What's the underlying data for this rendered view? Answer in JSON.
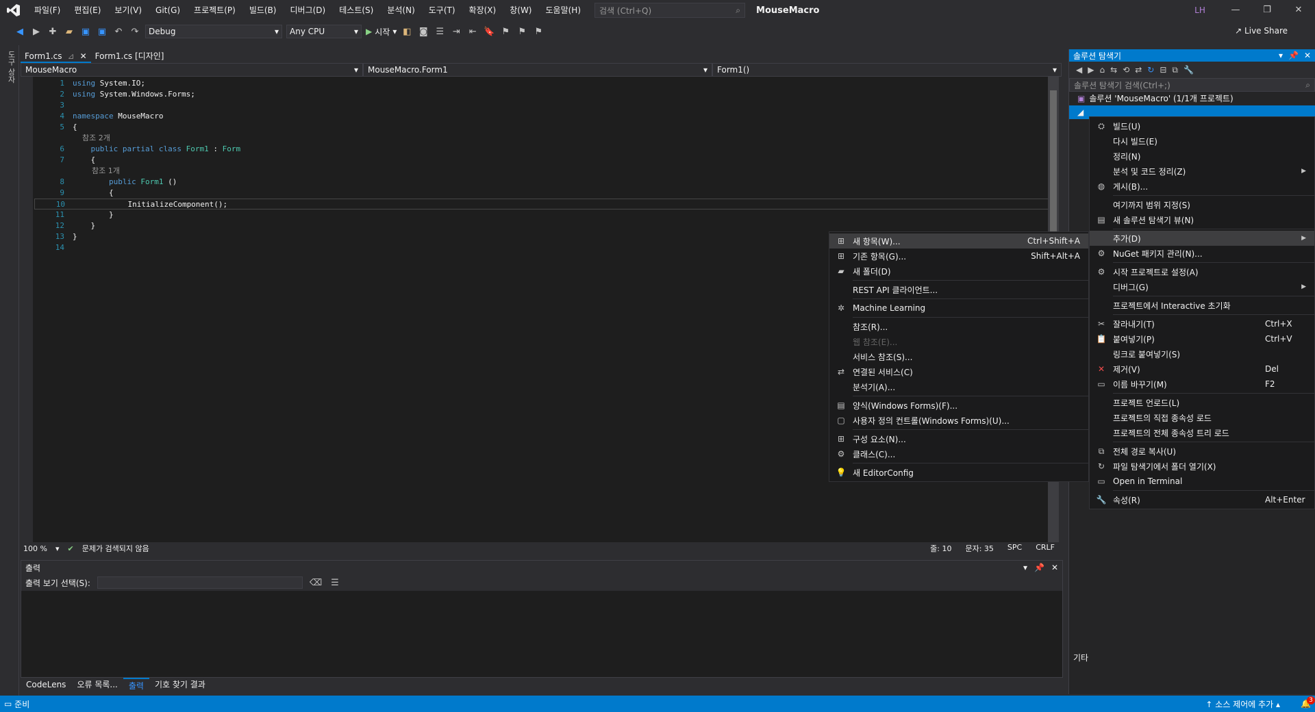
{
  "app": {
    "title": "MouseMacro",
    "user_initials": "LH",
    "accent": "#007acc"
  },
  "menu": [
    "파일(F)",
    "편집(E)",
    "보기(V)",
    "Git(G)",
    "프로젝트(P)",
    "빌드(B)",
    "디버그(D)",
    "테스트(S)",
    "분석(N)",
    "도구(T)",
    "확장(X)",
    "창(W)",
    "도움말(H)"
  ],
  "search": {
    "placeholder": "검색 (Ctrl+Q)"
  },
  "toolbar": {
    "config": "Debug",
    "platform": "Any CPU",
    "start_label": "시작",
    "live_share": "Live Share"
  },
  "left_rail": {
    "label": "도구 상자"
  },
  "doc_tabs": [
    {
      "label": "Form1.cs",
      "active": true
    },
    {
      "label": "Form1.cs [디자인]",
      "active": false
    }
  ],
  "nav_bar": {
    "project": "MouseMacro",
    "class": "MouseMacro.Form1",
    "member": "Form1()"
  },
  "code_lines": [
    {
      "num": "1",
      "parts": [
        [
          "kw",
          "using"
        ],
        [
          "",
          "System.IO;"
        ]
      ]
    },
    {
      "num": "2",
      "parts": [
        [
          "kw",
          "using"
        ],
        [
          "",
          "System.Windows.Forms;"
        ]
      ]
    },
    {
      "num": "3",
      "parts": []
    },
    {
      "num": "4",
      "parts": [
        [
          "kw",
          "namespace"
        ],
        [
          "",
          "MouseMacro"
        ]
      ]
    },
    {
      "num": "5",
      "parts": [
        [
          "",
          "{"
        ]
      ]
    },
    {
      "num": "",
      "parts": [
        [
          "ref",
          "    참조 2개"
        ]
      ]
    },
    {
      "num": "6",
      "parts": [
        [
          "kw",
          "    public partial class"
        ],
        [
          "ty",
          "Form1"
        ],
        [
          "",
          ":"
        ],
        [
          "ty",
          "Form"
        ]
      ]
    },
    {
      "num": "7",
      "parts": [
        [
          "",
          "    {"
        ]
      ]
    },
    {
      "num": "",
      "parts": [
        [
          "ref",
          "        참조 1개"
        ]
      ]
    },
    {
      "num": "8",
      "parts": [
        [
          "kw",
          "        public"
        ],
        [
          "ty",
          "Form1"
        ],
        [
          "",
          "()"
        ]
      ]
    },
    {
      "num": "9",
      "parts": [
        [
          "",
          "        {"
        ]
      ]
    },
    {
      "num": "10",
      "parts": [
        [
          "",
          "            InitializeComponent();"
        ]
      ]
    },
    {
      "num": "11",
      "parts": [
        [
          "",
          "        }"
        ]
      ]
    },
    {
      "num": "12",
      "parts": [
        [
          "",
          "    }"
        ]
      ]
    },
    {
      "num": "13",
      "parts": [
        [
          "",
          "}"
        ]
      ]
    },
    {
      "num": "14",
      "parts": []
    }
  ],
  "editor_status": {
    "zoom": "100 %",
    "issues": "문제가 검색되지 않음",
    "line": "줄: 10",
    "char": "문자: 35",
    "spc": "SPC",
    "crlf": "CRLF"
  },
  "output": {
    "title": "출력",
    "source_label": "출력 보기 선택(S):"
  },
  "bottom_tabs": [
    {
      "label": "CodeLens",
      "active": false
    },
    {
      "label": "오류 목록...",
      "active": false
    },
    {
      "label": "출력",
      "active": true
    },
    {
      "label": "기호 찾기 결과",
      "active": false
    }
  ],
  "solution_explorer": {
    "title": "솔루션 탐색기",
    "search_placeholder": "솔루션 탐색기 검색(Ctrl+;)",
    "solution_row": "솔루션 'MouseMacro' (1/1개 프로젝트)",
    "misc": "기타"
  },
  "project_menu": [
    {
      "icon": "build-icon",
      "glyph": "⛭",
      "label": "빌드(U)",
      "shortcut": ""
    },
    {
      "icon": "",
      "glyph": "",
      "label": "다시 빌드(E)",
      "shortcut": ""
    },
    {
      "icon": "",
      "glyph": "",
      "label": "정리(N)",
      "shortcut": ""
    },
    {
      "icon": "",
      "glyph": "",
      "label": "분석 및 코드 정리(Z)",
      "shortcut": "",
      "submenu": true
    },
    {
      "icon": "publish-icon",
      "glyph": "◍",
      "label": "게시(B)...",
      "shortcut": ""
    },
    {
      "sep": true
    },
    {
      "icon": "",
      "glyph": "",
      "label": "여기까지 범위 지정(S)",
      "shortcut": ""
    },
    {
      "icon": "new-view-icon",
      "glyph": "▤",
      "label": "새 솔루션 탐색기 뷰(N)",
      "shortcut": ""
    },
    {
      "sep": true
    },
    {
      "icon": "",
      "glyph": "",
      "label": "추가(D)",
      "shortcut": "",
      "submenu": true,
      "hl": true
    },
    {
      "icon": "nuget-icon",
      "glyph": "⚙",
      "label": "NuGet 패키지 관리(N)...",
      "shortcut": ""
    },
    {
      "sep": true
    },
    {
      "icon": "gear-icon",
      "glyph": "⚙",
      "label": "시작 프로젝트로 설정(A)",
      "shortcut": ""
    },
    {
      "icon": "",
      "glyph": "",
      "label": "디버그(G)",
      "shortcut": "",
      "submenu": true
    },
    {
      "sep": true
    },
    {
      "icon": "",
      "glyph": "",
      "label": "프로젝트에서 Interactive 초기화",
      "shortcut": ""
    },
    {
      "sep": true
    },
    {
      "icon": "cut-icon",
      "glyph": "✂",
      "label": "잘라내기(T)",
      "shortcut": "Ctrl+X"
    },
    {
      "icon": "paste-icon",
      "glyph": "📋",
      "label": "붙여넣기(P)",
      "shortcut": "Ctrl+V"
    },
    {
      "icon": "",
      "glyph": "",
      "label": "링크로 붙여넣기(S)",
      "shortcut": ""
    },
    {
      "icon": "remove-icon",
      "glyph": "✕",
      "label": "제거(V)",
      "shortcut": "Del",
      "red": true
    },
    {
      "icon": "rename-icon",
      "glyph": "▭",
      "label": "이름 바꾸기(M)",
      "shortcut": "F2"
    },
    {
      "sep": true
    },
    {
      "icon": "",
      "glyph": "",
      "label": "프로젝트 언로드(L)",
      "shortcut": ""
    },
    {
      "icon": "",
      "glyph": "",
      "label": "프로젝트의 직접 종속성 로드",
      "shortcut": ""
    },
    {
      "icon": "",
      "glyph": "",
      "label": "프로젝트의 전체 종속성 트리 로드",
      "shortcut": ""
    },
    {
      "sep": true
    },
    {
      "icon": "copy-icon",
      "glyph": "⧉",
      "label": "전체 경로 복사(U)",
      "shortcut": ""
    },
    {
      "icon": "open-folder-icon",
      "glyph": "↻",
      "label": "파일 탐색기에서 폴더 열기(X)",
      "shortcut": ""
    },
    {
      "icon": "terminal-icon",
      "glyph": "▭",
      "label": "Open in Terminal",
      "shortcut": ""
    },
    {
      "sep": true
    },
    {
      "icon": "wrench-icon",
      "glyph": "🔧",
      "label": "속성(R)",
      "shortcut": "Alt+Enter"
    }
  ],
  "add_menu": [
    {
      "icon": "new-item-icon",
      "glyph": "⊞",
      "label": "새 항목(W)...",
      "shortcut": "Ctrl+Shift+A",
      "hl": true
    },
    {
      "icon": "existing-item-icon",
      "glyph": "⊞",
      "label": "기존 항목(G)...",
      "shortcut": "Shift+Alt+A"
    },
    {
      "icon": "new-folder-icon",
      "glyph": "▰",
      "label": "새 폴더(D)",
      "shortcut": ""
    },
    {
      "sep": true
    },
    {
      "icon": "",
      "glyph": "",
      "label": "REST API 클라이언트...",
      "shortcut": ""
    },
    {
      "sep": true
    },
    {
      "icon": "ml-icon",
      "glyph": "✲",
      "label": "Machine Learning",
      "shortcut": ""
    },
    {
      "sep": true
    },
    {
      "icon": "",
      "glyph": "",
      "label": "참조(R)...",
      "shortcut": ""
    },
    {
      "icon": "",
      "glyph": "",
      "label": "웹 참조(E)...",
      "shortcut": "",
      "disabled": true
    },
    {
      "icon": "",
      "glyph": "",
      "label": "서비스 참조(S)...",
      "shortcut": ""
    },
    {
      "icon": "connected-service-icon",
      "glyph": "⇄",
      "label": "연결된 서비스(C)",
      "shortcut": ""
    },
    {
      "icon": "",
      "glyph": "",
      "label": "분석기(A)...",
      "shortcut": ""
    },
    {
      "sep": true
    },
    {
      "icon": "form-icon",
      "glyph": "▤",
      "label": "양식(Windows Forms)(F)...",
      "shortcut": ""
    },
    {
      "icon": "user-control-icon",
      "glyph": "▢",
      "label": "사용자 정의 컨트롤(Windows Forms)(U)...",
      "shortcut": ""
    },
    {
      "sep": true
    },
    {
      "icon": "component-icon",
      "glyph": "⊞",
      "label": "구성 요소(N)...",
      "shortcut": ""
    },
    {
      "icon": "class-icon",
      "glyph": "⚙",
      "label": "클래스(C)...",
      "shortcut": ""
    },
    {
      "sep": true
    },
    {
      "icon": "editorconfig-icon",
      "glyph": "💡",
      "label": "새 EditorConfig",
      "shortcut": ""
    }
  ],
  "statusbar": {
    "ready": "준비",
    "source_control": "소스 제어에 추가",
    "notifications": "3"
  }
}
